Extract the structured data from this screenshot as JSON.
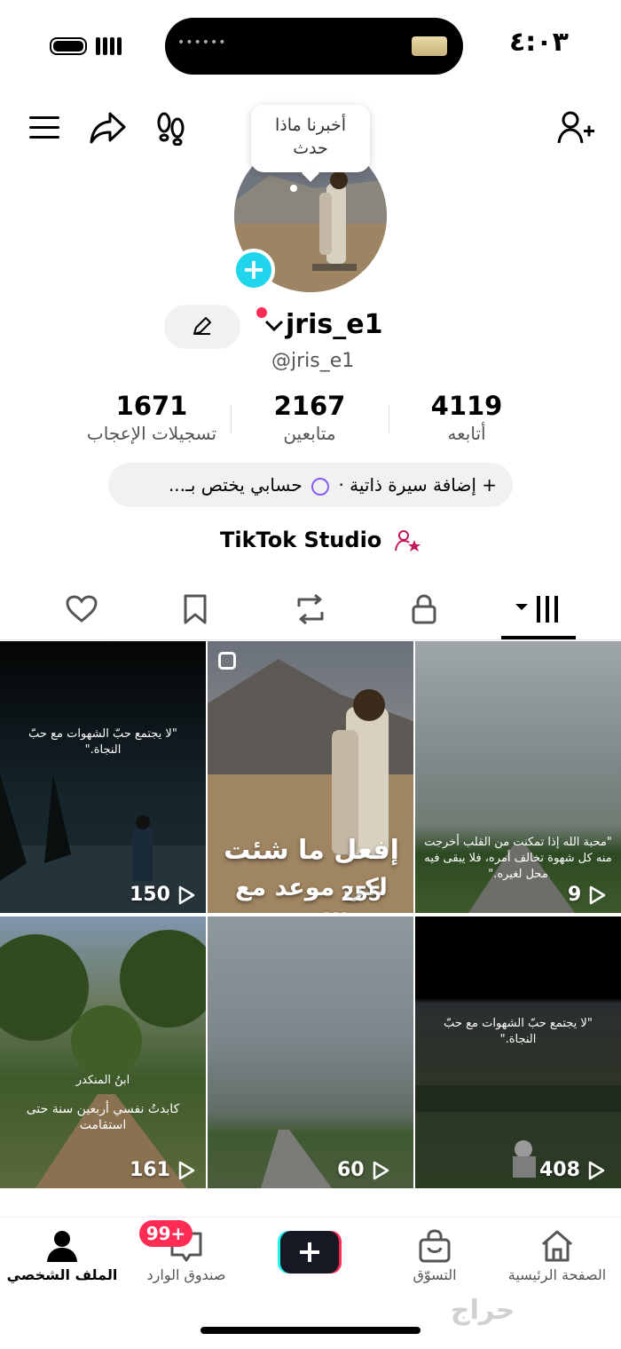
{
  "status_bar": {
    "time": "٤:٠٣",
    "island_dots": "••••••"
  },
  "bubble": {
    "text_line1": "أخبرنا ماذا",
    "text_line2": "حدث"
  },
  "profile": {
    "display_name": "jris_e1",
    "handle": "@jris_e1",
    "stats": [
      {
        "value": "4119",
        "label": "أتابعه"
      },
      {
        "value": "2167",
        "label": "متابعين"
      },
      {
        "value": "1671",
        "label": "تسجيلات الإعجاب"
      }
    ],
    "bio_pill": {
      "add": "+ إضافة سيرة ذاتية",
      "dot": "·",
      "text": "حسابي يختص بـ..."
    },
    "studio": "TikTok Studio"
  },
  "tabs": [
    "videos-icon",
    "lock-icon",
    "repost-icon",
    "bookmark-icon",
    "heart-icon"
  ],
  "videos": [
    {
      "views": "9",
      "caption": "\"محبة الله إذا تمكنت من القلب أخرجت منه كل شهوة تخالف أمره، فلا يبقى فيه محل لغيره.\""
    },
    {
      "views": "255",
      "big_line1": "إفعل ما شئت",
      "big_line2": "لكن موعد مع الله ب"
    },
    {
      "views": "150",
      "caption": "\"لا يجتمع حبّ الشهوات مع حبّ النجاة.\""
    },
    {
      "views": "408",
      "caption": "\"لا يجتمع حبّ الشهوات مع حبّ النجاة.\""
    },
    {
      "views": "60"
    },
    {
      "views": "161",
      "caption_title": "ابنُ المنكدر",
      "caption": "كابدتُ نفسي أربعين سنة حتى استقامت"
    }
  ],
  "nav": {
    "home": "الصفحة الرئيسية",
    "shop": "التسوّق",
    "inbox": "صندوق الوارد",
    "inbox_badge": "99+",
    "profile": "الملف الشخصي"
  },
  "watermark": "حراج"
}
